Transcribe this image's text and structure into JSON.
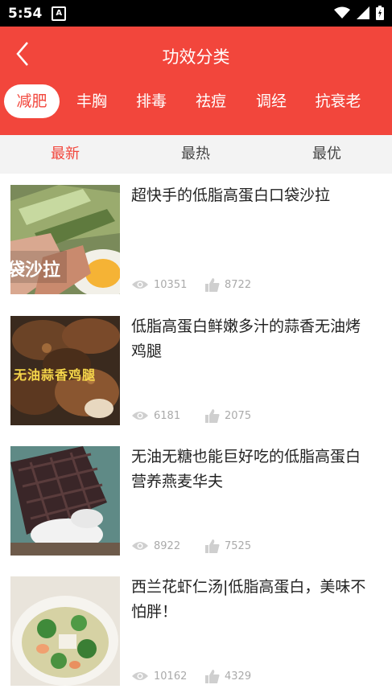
{
  "status_bar": {
    "time": "5:54",
    "notification_letter": "A"
  },
  "header": {
    "title": "功效分类"
  },
  "categories": [
    {
      "label": "减肥",
      "active": true
    },
    {
      "label": "丰胸",
      "active": false
    },
    {
      "label": "排毒",
      "active": false
    },
    {
      "label": "祛痘",
      "active": false
    },
    {
      "label": "调经",
      "active": false
    },
    {
      "label": "抗衰老",
      "active": false
    }
  ],
  "sort_tabs": [
    {
      "label": "最新",
      "active": true
    },
    {
      "label": "最热",
      "active": false
    },
    {
      "label": "最优",
      "active": false
    }
  ],
  "recipes": [
    {
      "title": "超快手的低脂高蛋白口袋沙拉",
      "views": "10351",
      "likes": "8722",
      "thumb_text": "袋沙拉"
    },
    {
      "title": "低脂高蛋白鲜嫩多汁的蒜香无油烤鸡腿",
      "views": "6181",
      "likes": "2075",
      "thumb_text": "无油蒜香鸡腿"
    },
    {
      "title": "无油无糖也能巨好吃的低脂高蛋白营养燕麦华夫",
      "views": "8922",
      "likes": "7525"
    },
    {
      "title": "西兰花虾仁汤|低脂高蛋白，美味不怕胖！",
      "views": "10162",
      "likes": "4329"
    }
  ],
  "colors": {
    "primary": "#f2463c",
    "sortbar_bg": "#f3f3f3"
  }
}
